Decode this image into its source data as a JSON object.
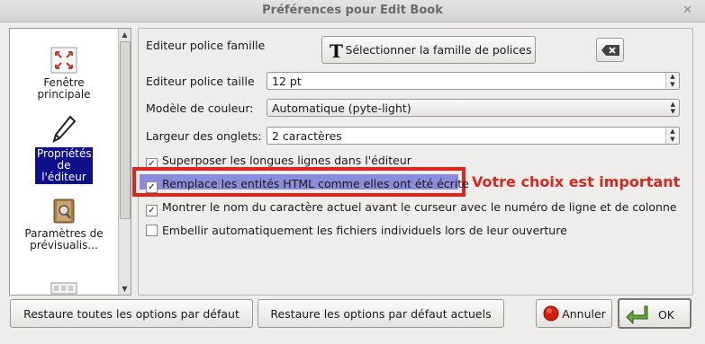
{
  "window": {
    "title": "Préférences pour Edit Book",
    "close_glyph": "✕"
  },
  "sidebar": {
    "items": [
      {
        "label": "Fenêtre principale",
        "icon": "window-icon",
        "selected": false
      },
      {
        "label": "Propriétés de l'éditeur",
        "icon": "pen-icon",
        "selected": true
      },
      {
        "label": "Paramètres de prévisualis...",
        "icon": "preview-book-icon",
        "selected": false
      }
    ]
  },
  "editor": {
    "font_family_label": "Editeur police famille",
    "font_family_button": "Sélectionner la famille de polices",
    "font_size_label": "Editeur police taille",
    "font_size_value": "12 pt",
    "color_scheme_label": "Modèle de couleur:",
    "color_scheme_value": "Automatique (pyte-light)",
    "tab_width_label": "Largeur des onglets:",
    "tab_width_value": "2 caractères"
  },
  "options": [
    {
      "label": "Superposer les longues lignes dans l'éditeur",
      "checked": true
    },
    {
      "label": "Remplace les entités HTML comme elles ont été écrite",
      "checked": true,
      "highlighted": true
    },
    {
      "label": "Montrer le nom du caractère actuel avant le curseur avec le numéro de ligne et de colonne",
      "checked": true
    },
    {
      "label": "Embellir automatiquement les fichiers individuels lors de leur ouverture",
      "checked": false
    }
  ],
  "annotation": "Votre choix est important",
  "footer": {
    "restore_all": "Restaure toutes les options par défaut",
    "restore_current": "Restaure les options par défaut actuels",
    "cancel": "Annuler",
    "ok": "OK"
  },
  "colors": {
    "selection": "#0f0f8a",
    "highlight_border": "#e0231c",
    "annotation": "#d42a1e"
  }
}
